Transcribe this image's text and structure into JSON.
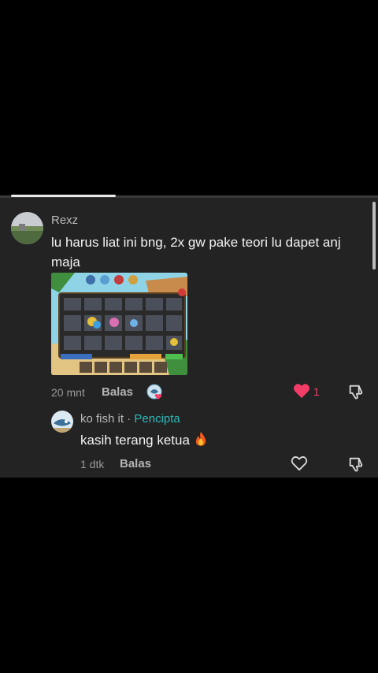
{
  "comments": [
    {
      "username": "Rexz",
      "text": "lu harus liat ini bng, 2x gw pake teori lu dapet anj maja",
      "time": "20 mnt",
      "reply_label": "Balas",
      "like_count": "1",
      "liked": true,
      "has_image": true
    },
    {
      "username": "ko fish it",
      "separator": "·",
      "badge": "Pencipta",
      "text": "kasih terang ketua",
      "time": "1 dtk",
      "reply_label": "Balas",
      "liked": false
    }
  ],
  "colors": {
    "accent_like": "#f23d68",
    "creator_badge": "#2fb8b9",
    "panel_bg": "#232323"
  },
  "icons": [
    "heart-filled-icon",
    "heart-outline-icon",
    "dislike-icon",
    "fire-emoji-icon",
    "creator-liked-avatar-icon"
  ]
}
